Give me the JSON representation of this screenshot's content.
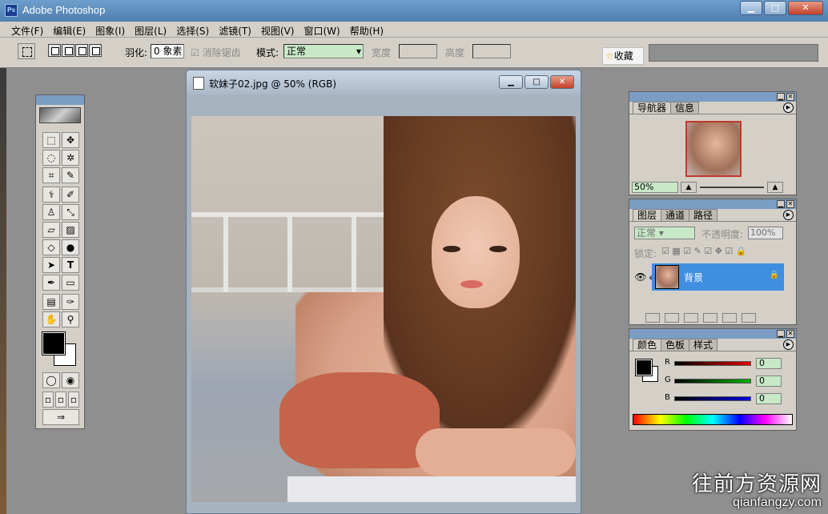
{
  "window": {
    "title": "Adobe Photoshop",
    "icon": "Ps"
  },
  "menu": [
    "文件(F)",
    "编辑(E)",
    "图象(I)",
    "图层(L)",
    "选择(S)",
    "滤镜(T)",
    "视图(V)",
    "窗口(W)",
    "帮助(H)"
  ],
  "options": {
    "feather_label": "羽化:",
    "feather_value": "0 象素",
    "antialias_label": "消除锯齿",
    "mode_label": "模式:",
    "mode_value": "正常",
    "width_label": "宽度",
    "height_label": "高度",
    "favorites_label": "收藏"
  },
  "document": {
    "title": "软妹子02.jpg @ 50% (RGB)"
  },
  "navigator": {
    "tabs": [
      "导航器",
      "信息"
    ],
    "zoom": "50%"
  },
  "layers": {
    "tabs": [
      "图层",
      "通道",
      "路径"
    ],
    "blend_mode": "正常",
    "opacity_label": "不透明度:",
    "opacity_value": "100%",
    "lock_label": "锁定:",
    "layer_name": "背景"
  },
  "color": {
    "tabs": [
      "颜色",
      "色板",
      "样式"
    ],
    "r_label": "R",
    "g_label": "G",
    "b_label": "B",
    "r_value": "0",
    "g_value": "0",
    "b_value": "0",
    "r_track": "#e00000",
    "g_track": "#00b000",
    "b_track": "#0000e0"
  },
  "watermark": {
    "cn": "往前方资源网",
    "en": "qianfangzy.com"
  },
  "icons": {
    "tools": [
      "marquee-icon",
      "move-icon",
      "lasso-icon",
      "magic-wand-icon",
      "crop-icon",
      "eyedropper-slice-icon",
      "healing-icon",
      "brush-icon",
      "stamp-icon",
      "history-brush-icon",
      "eraser-icon",
      "gradient-icon",
      "blur-icon",
      "dodge-icon",
      "path-select-icon",
      "type-icon",
      "pen-icon",
      "shape-icon",
      "notes-icon",
      "eyedropper-icon",
      "hand-icon",
      "zoom-icon"
    ]
  }
}
